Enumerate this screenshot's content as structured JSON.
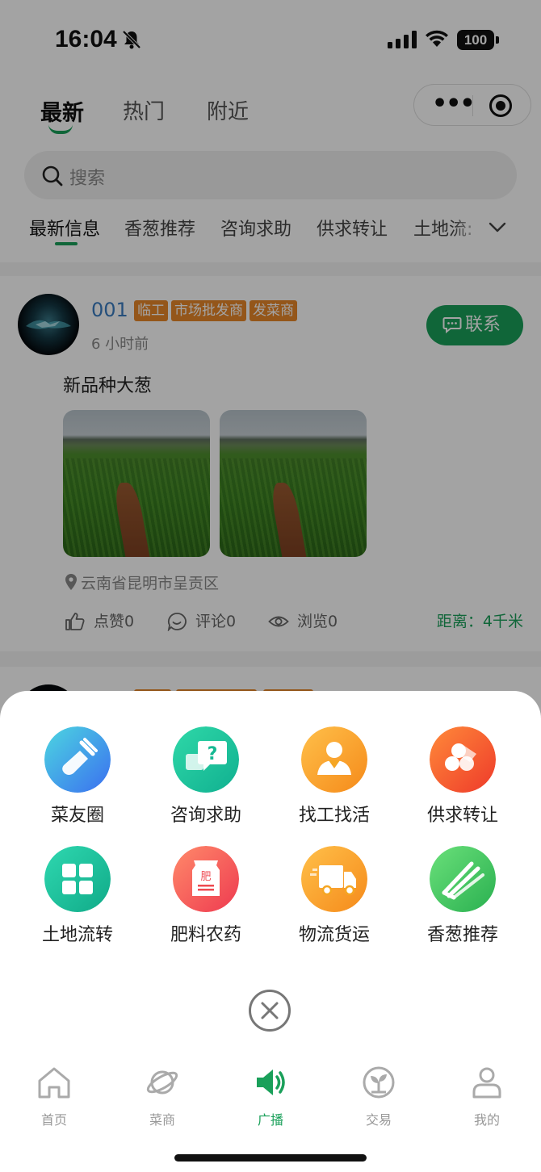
{
  "status_bar": {
    "time": "16:04",
    "battery": "100"
  },
  "header": {
    "tabs": [
      {
        "label": "最新",
        "active": true
      },
      {
        "label": "热门",
        "active": false
      },
      {
        "label": "附近",
        "active": false
      }
    ],
    "search": {
      "placeholder": "搜索"
    },
    "categories": [
      "最新信息",
      "香葱推荐",
      "咨询求助",
      "供求转让",
      "土地流:"
    ]
  },
  "post": {
    "username": "001",
    "tags": [
      "临工",
      "市场批发商",
      "发菜商"
    ],
    "time": "6 小时前",
    "contact_label": "联系",
    "text": "新品种大葱",
    "location": "云南省昆明市呈贡区",
    "likes": "点赞0",
    "comments": "评论0",
    "views": "浏览0",
    "distance": "距离：4千米"
  },
  "action_sheet": {
    "items": [
      {
        "label": "菜友圈",
        "icon": "shovel-icon",
        "color": "#4a8ff0"
      },
      {
        "label": "咨询求助",
        "icon": "question-chat-icon",
        "color": "#1cc09a"
      },
      {
        "label": "找工找活",
        "icon": "worker-icon",
        "color": "#f5a623"
      },
      {
        "label": "供求转让",
        "icon": "logs-icon",
        "color": "#f25a2a"
      },
      {
        "label": "土地流转",
        "icon": "land-grid-icon",
        "color": "#1cc09a"
      },
      {
        "label": "肥料农药",
        "icon": "fertilizer-bag-icon",
        "color": "#f0505a"
      },
      {
        "label": "物流货运",
        "icon": "truck-icon",
        "color": "#f5a623"
      },
      {
        "label": "香葱推荐",
        "icon": "scallion-icon",
        "color": "#3cc060"
      }
    ]
  },
  "tabbar": {
    "items": [
      {
        "label": "首页",
        "icon": "home-icon",
        "active": false
      },
      {
        "label": "菜商",
        "icon": "planet-icon",
        "active": false
      },
      {
        "label": "广播",
        "icon": "speaker-icon",
        "active": true
      },
      {
        "label": "交易",
        "icon": "sprout-icon",
        "active": false
      },
      {
        "label": "我的",
        "icon": "user-icon",
        "active": false
      }
    ]
  },
  "colors": {
    "accent": "#1aa05a",
    "tag": "#e8872a",
    "username": "#3a7cc0"
  }
}
